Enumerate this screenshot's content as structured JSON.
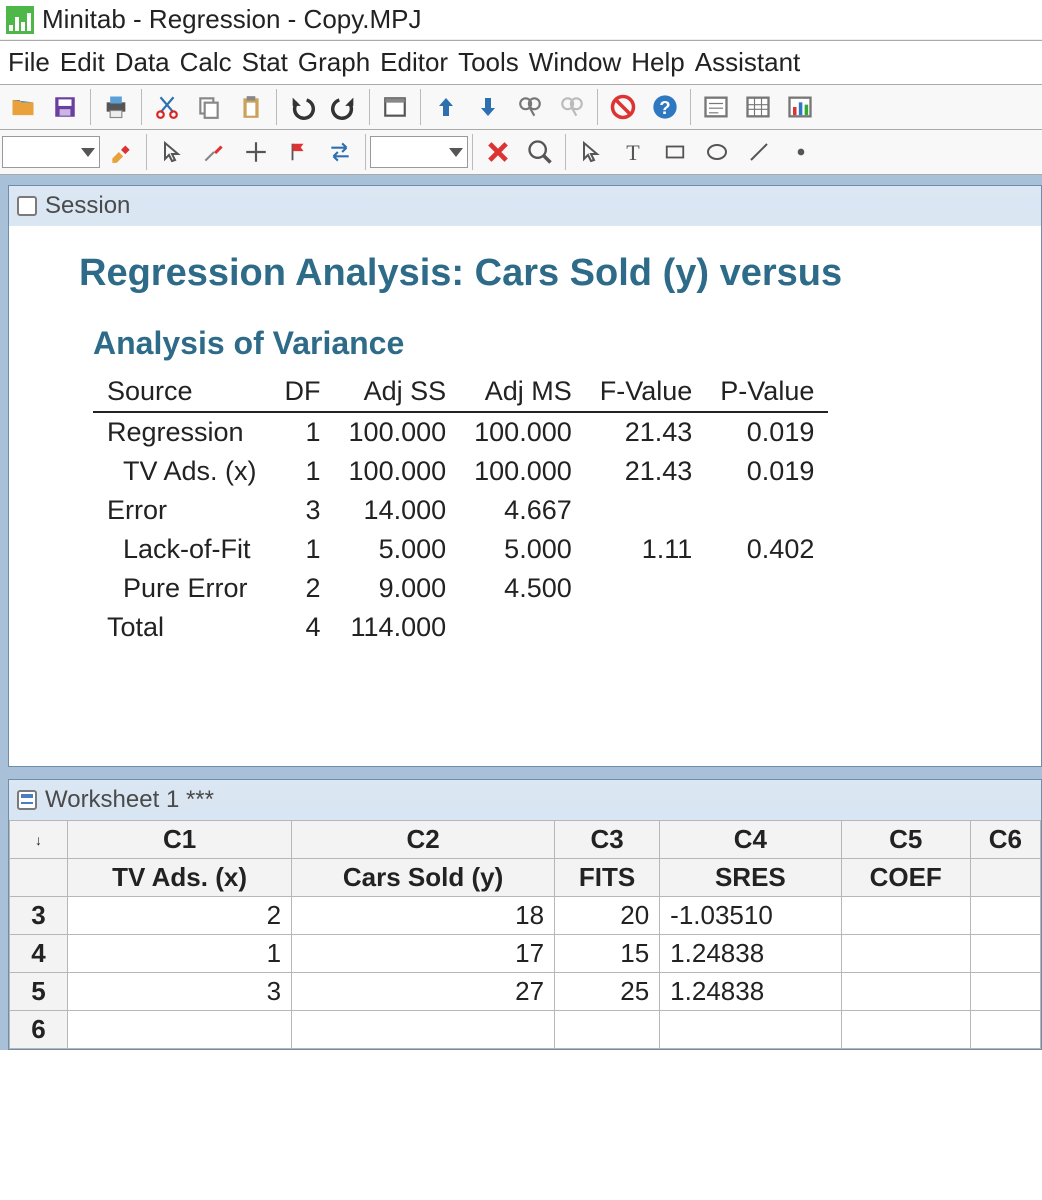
{
  "window": {
    "title": "Minitab - Regression - Copy.MPJ"
  },
  "menu": {
    "file": "File",
    "edit": "Edit",
    "data": "Data",
    "calc": "Calc",
    "stat": "Stat",
    "graph": "Graph",
    "editor": "Editor",
    "tools": "Tools",
    "window": "Window",
    "help": "Help",
    "assistant": "Assistant"
  },
  "session": {
    "title": "Session",
    "heading": "Regression Analysis: Cars Sold (y) versus ",
    "aov_title": "Analysis of Variance",
    "cols": {
      "source": "Source",
      "df": "DF",
      "adjss": "Adj SS",
      "adjms": "Adj MS",
      "f": "F-Value",
      "p": "P-Value"
    },
    "rows": [
      {
        "src": "Regression",
        "indent": 0,
        "df": "1",
        "adjss": "100.000",
        "adjms": "100.000",
        "f": "21.43",
        "p": "0.019"
      },
      {
        "src": "TV Ads. (x)",
        "indent": 1,
        "df": "1",
        "adjss": "100.000",
        "adjms": "100.000",
        "f": "21.43",
        "p": "0.019"
      },
      {
        "src": "Error",
        "indent": 0,
        "df": "3",
        "adjss": "14.000",
        "adjms": "4.667",
        "f": "",
        "p": ""
      },
      {
        "src": "Lack-of-Fit",
        "indent": 1,
        "df": "1",
        "adjss": "5.000",
        "adjms": "5.000",
        "f": "1.11",
        "p": "0.402"
      },
      {
        "src": "Pure Error",
        "indent": 1,
        "df": "2",
        "adjss": "9.000",
        "adjms": "4.500",
        "f": "",
        "p": ""
      },
      {
        "src": "Total",
        "indent": 0,
        "df": "4",
        "adjss": "114.000",
        "adjms": "",
        "f": "",
        "p": ""
      }
    ]
  },
  "worksheet": {
    "title": "Worksheet 1 ***",
    "corner": "↓",
    "cols": [
      "C1",
      "C2",
      "C3",
      "C4",
      "C5",
      "C6"
    ],
    "names": [
      "TV Ads. (x)",
      "Cars Sold (y)",
      "FITS",
      "SRES",
      "COEF",
      ""
    ],
    "rows": [
      {
        "n": "3",
        "c": [
          "2",
          "18",
          "20",
          "-1.03510",
          "",
          ""
        ]
      },
      {
        "n": "4",
        "c": [
          "1",
          "17",
          "15",
          "1.24838",
          "",
          ""
        ]
      },
      {
        "n": "5",
        "c": [
          "3",
          "27",
          "25",
          "1.24838",
          "",
          ""
        ]
      },
      {
        "n": "6",
        "c": [
          "",
          "",
          "",
          "",
          "",
          ""
        ]
      }
    ]
  },
  "chart_data": {
    "type": "table",
    "title": "Analysis of Variance",
    "columns": [
      "Source",
      "DF",
      "Adj SS",
      "Adj MS",
      "F-Value",
      "P-Value"
    ],
    "rows": [
      [
        "Regression",
        1,
        100.0,
        100.0,
        21.43,
        0.019
      ],
      [
        "TV Ads. (x)",
        1,
        100.0,
        100.0,
        21.43,
        0.019
      ],
      [
        "Error",
        3,
        14.0,
        4.667,
        null,
        null
      ],
      [
        "Lack-of-Fit",
        1,
        5.0,
        5.0,
        1.11,
        0.402
      ],
      [
        "Pure Error",
        2,
        9.0,
        4.5,
        null,
        null
      ],
      [
        "Total",
        4,
        114.0,
        null,
        null,
        null
      ]
    ]
  }
}
